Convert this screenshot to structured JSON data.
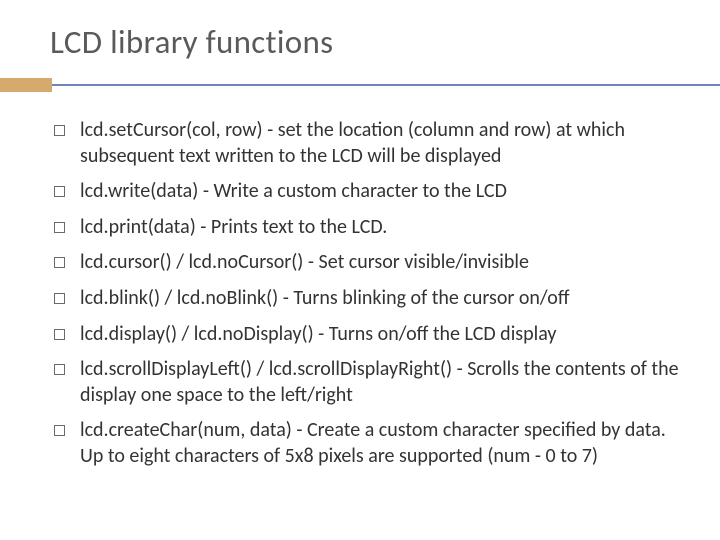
{
  "title": "LCD library functions",
  "items": [
    "lcd.setCursor(col, row) - set the location (column and row) at which subsequent text written to the LCD will be displayed",
    "lcd.write(data) - Write a custom character to the LCD",
    "lcd.print(data) - Prints text to the LCD.",
    "lcd.cursor() / lcd.noCursor() - Set cursor visible/invisible",
    "lcd.blink() / lcd.noBlink() - Turns blinking of the cursor on/off",
    "lcd.display() / lcd.noDisplay() - Turns on/off the LCD display",
    "lcd.scrollDisplayLeft() / lcd.scrollDisplayRight() - Scrolls the contents of the display one space to the left/right",
    "lcd.createChar(num, data) - Create a custom character specified by data. Up to eight characters of 5x8 pixels are supported (num - 0 to 7)"
  ]
}
